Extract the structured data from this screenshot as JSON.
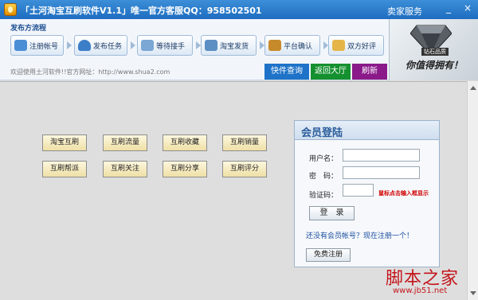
{
  "window": {
    "title": "「土河淘宝互刷软件V1.1」唯一官方客服QQ：958502501",
    "seller_service": "卖家服务",
    "minimize": "_",
    "close": "×"
  },
  "process": {
    "title": "发布方流程",
    "steps": [
      {
        "label": "注册帐号",
        "icon": "user-icon",
        "color": "#4a8fd6"
      },
      {
        "label": "发布任务",
        "icon": "shield-icon",
        "color": "#3d7ec8"
      },
      {
        "label": "等待接手",
        "icon": "keyboard-icon",
        "color": "#7aa7d4"
      },
      {
        "label": "淘宝发货",
        "icon": "grid-icon",
        "color": "#5c8fc4"
      },
      {
        "label": "平台确认",
        "icon": "pen-icon",
        "color": "#c78a2a"
      },
      {
        "label": "双方好评",
        "icon": "envelope-icon",
        "color": "#e5b548"
      }
    ],
    "welcome": "欢迎使用土河软件!!官方网址：http://www.shua2.com"
  },
  "banner": {
    "badge": "钻石品质",
    "slogan": "你值得拥有！"
  },
  "nav": {
    "quick_query": "快件查询",
    "back_hall": "返回大厅",
    "refresh": "刷新",
    "colors": {
      "quick_query": "#1e73c8",
      "back_hall": "#15902f",
      "refresh": "#8a1a8a"
    }
  },
  "functions": [
    "淘宝互刷",
    "互刷流量",
    "互刷收藏",
    "互刷销量",
    "互刷帮派",
    "互刷关注",
    "互刷分享",
    "互刷评分"
  ],
  "login": {
    "title": "会员登陆",
    "username_label": "用户名：",
    "password_label": "密　码：",
    "captcha_label": "验证码：",
    "captcha_hint": "鼠标点击输入框显示",
    "login_button": "登　录",
    "register_prompt": "还没有会员帐号？现在注册一个！",
    "register_button": "免费注册"
  },
  "watermark": {
    "logo": "脚本之家",
    "url": "www.jb51.net"
  }
}
